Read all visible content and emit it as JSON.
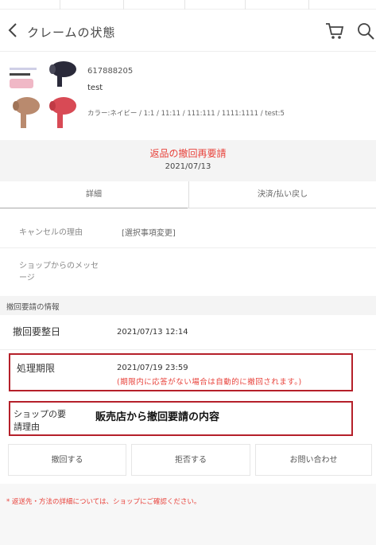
{
  "header": {
    "title": "クレームの状態"
  },
  "product": {
    "id": "617888205",
    "name": "test",
    "options": "カラー:ネイビー / 1:1 / 11:11 / 111:111 / 1111:1111 / test:5"
  },
  "status": {
    "title": "返品の撤回再要請",
    "date": "2021/07/13"
  },
  "tabs": [
    {
      "label": "詳細"
    },
    {
      "label": "決済/払い戻し"
    }
  ],
  "details": {
    "cancel_reason_label": "キャンセルの理由",
    "cancel_reason_value": "[選択事項変更]",
    "shop_message_label_line1": "ショップからのメッセ",
    "shop_message_label_line2": "ージ"
  },
  "withdrawal_info": {
    "section_title": "撤回要請の情報",
    "request_date_label": "撤回要整日",
    "request_date_value": "2021/07/13 12:14",
    "deadline_label": "処理期限",
    "deadline_value": "2021/07/19 23:59",
    "deadline_warning": "(期限内に応答がない場合は自動的に撤回されます。)",
    "reason_label_line1": "ショップの要",
    "reason_label_line2": "請理由",
    "reason_value": "販売店から撤回要請の内容"
  },
  "actions": [
    {
      "label": "撤回する"
    },
    {
      "label": "拒否する"
    },
    {
      "label": "お問い合わせ"
    }
  ],
  "footer": {
    "note": "* 返送先・方法の詳細については、ショップにご確認ください。"
  },
  "colors": {
    "accent_red": "#e8413a",
    "highlight_box": "#b5202a"
  }
}
